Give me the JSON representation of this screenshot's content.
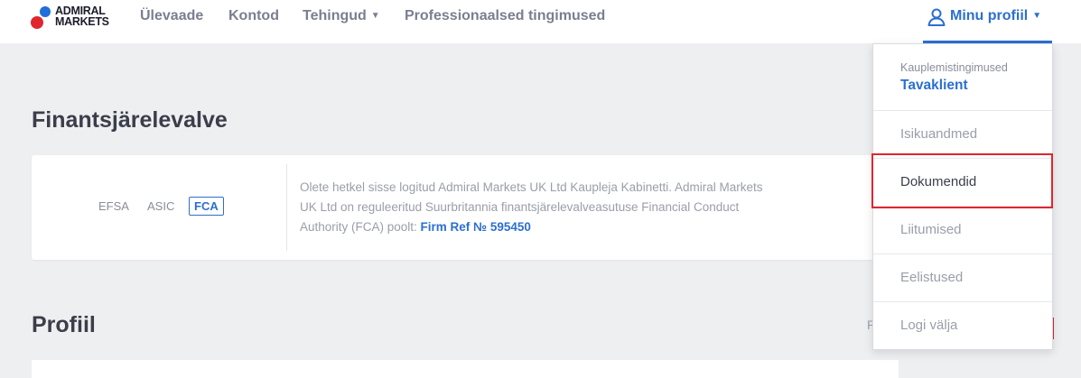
{
  "brand": {
    "line1": "ADMIRAL",
    "line2": "MARKETS"
  },
  "nav": {
    "overview": "Ülevaade",
    "accounts": "Kontod",
    "transactions": "Tehingud",
    "pro_terms": "Professionaalsed tingimused",
    "profile": "Minu profiil"
  },
  "section_supervision": {
    "title": "Finantsjärelevalve",
    "regulators": [
      "EFSA",
      "ASIC",
      "FCA"
    ],
    "active_regulator": "FCA",
    "description": "Olete hetkel sisse logitud Admiral Markets UK Ltd Kaupleja Kabinetti. Admiral Markets UK Ltd on reguleeritud Suurbritannia finantsjärelevalveasutuse Financial Conduct Authority (FCA) poolt: ",
    "link": "Firm Ref № 595450"
  },
  "section_profile": {
    "title": "Profiil",
    "hint": "P"
  },
  "dropdown": {
    "terms_label": "Kauplemistingimused",
    "terms_value": "Tavaklient",
    "items": [
      "Isikuandmed",
      "Dokumendid",
      "Liitumised",
      "Eelistused",
      "Logi välja"
    ],
    "highlighted": "Dokumendid"
  },
  "colors": {
    "accent": "#2c6fd1",
    "highlight": "#e0262f"
  }
}
